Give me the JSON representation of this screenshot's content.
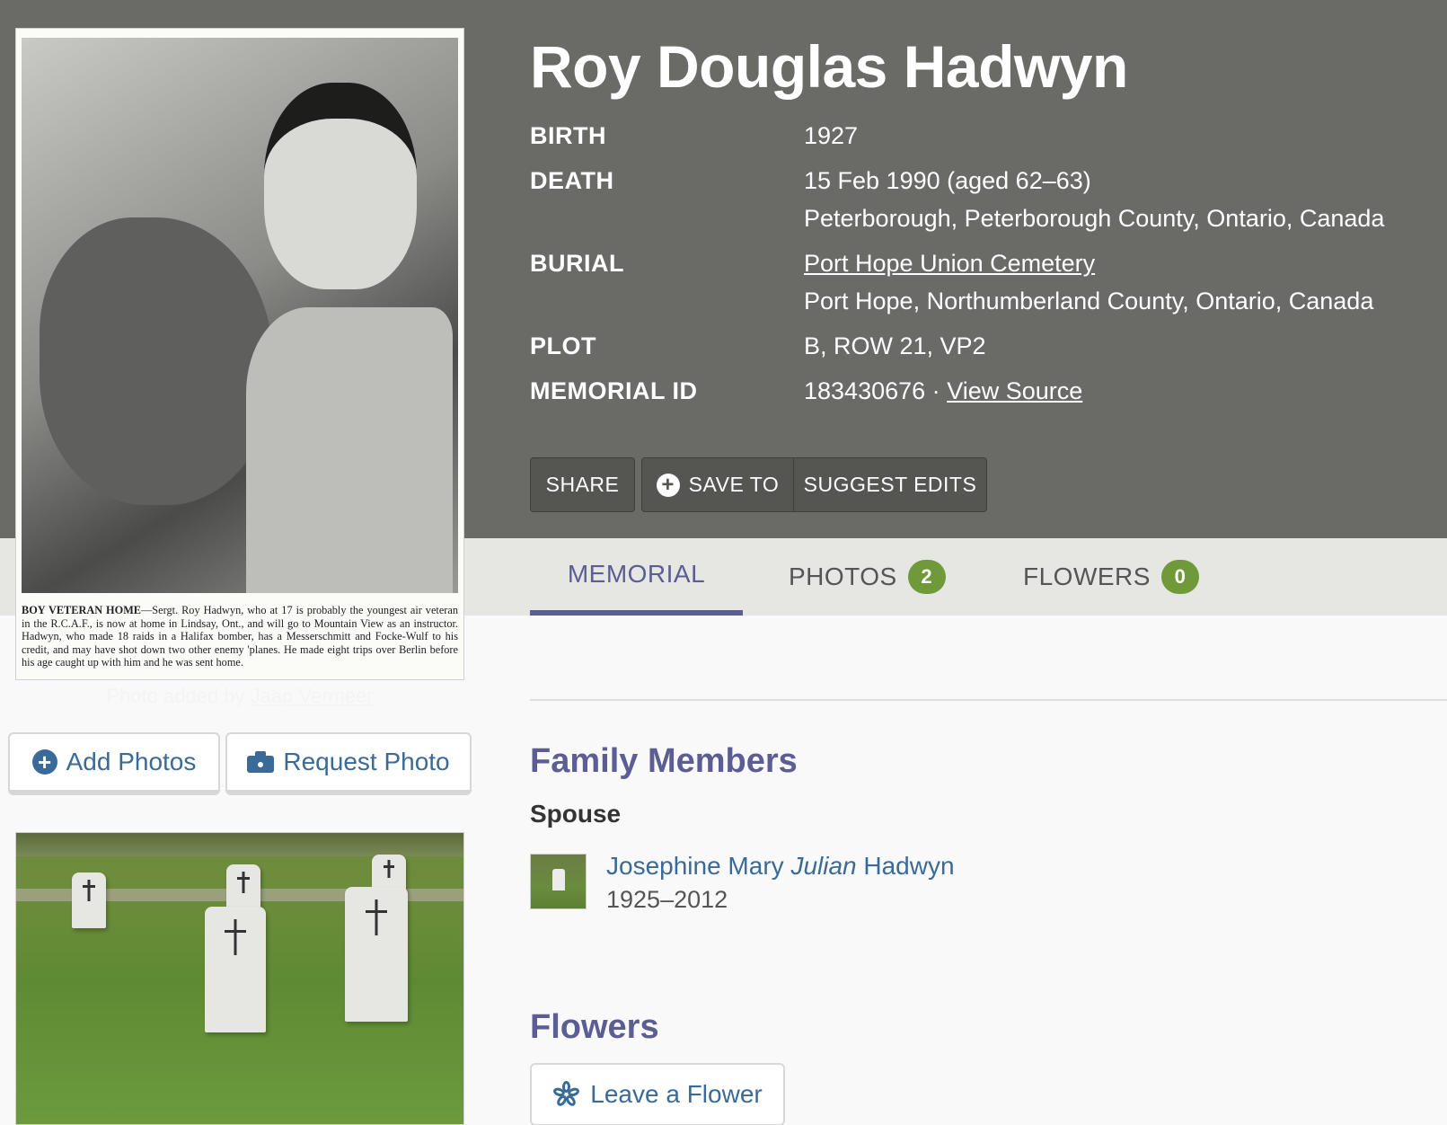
{
  "person": {
    "name": "Roy Douglas Hadwyn"
  },
  "facts": {
    "birth_label": "BIRTH",
    "birth_value": "1927",
    "death_label": "DEATH",
    "death_value": "15 Feb 1990 (aged 62–63)",
    "death_place": "Peterborough, Peterborough County, Ontario, Canada",
    "burial_label": "BURIAL",
    "burial_cemetery": "Port Hope Union Cemetery",
    "burial_place": "Port Hope, Northumberland County, Ontario, Canada",
    "plot_label": "PLOT",
    "plot_value": "B, ROW 21, VP2",
    "memorial_id_label": "MEMORIAL ID",
    "memorial_id_value": "183430676",
    "separator": "·",
    "view_source_label": "View Source"
  },
  "header_buttons": {
    "share": "SHARE",
    "save_to": "SAVE TO",
    "suggest_edits": "SUGGEST EDITS"
  },
  "tabs": {
    "memorial": "MEMORIAL",
    "photos": "PHOTOS",
    "photos_count": "2",
    "flowers": "FLOWERS",
    "flowers_count": "0"
  },
  "photo": {
    "caption_bold": "BOY VETERAN HOME",
    "caption_text": "—Sergt. Roy Hadwyn, who at 17 is probably the youngest air veteran in the R.C.A.F., is now at home in Lindsay, Ont., and will go to Mountain View as an instructor. Hadwyn, who made 18 raids in a Halifax bomber, has a Messerschmitt and Focke-Wulf to his credit, and may have shot down two other enemy 'planes. He made eight trips over Berlin before his age caught up with him and he was sent home.",
    "credit_prefix": "Photo added by",
    "credit_user": "Jaap Vermeer"
  },
  "photo_buttons": {
    "add_photos": "Add Photos",
    "request_photo": "Request Photo"
  },
  "family": {
    "title": "Family Members",
    "spouse_label": "Spouse",
    "spouse_first": "Josephine Mary",
    "spouse_maiden": "Julian",
    "spouse_last": "Hadwyn",
    "spouse_dates": "1925–2012"
  },
  "flowers": {
    "title": "Flowers",
    "leave_flower": "Leave a Flower"
  },
  "colors": {
    "header_bg": "#6a6a66",
    "accent_purple": "#5c5d93",
    "link_blue": "#3a6a97",
    "badge_green": "#6f9a3a"
  },
  "icons": {
    "add": "plus-circle-icon",
    "camera": "camera-icon",
    "save": "plus-circle-icon",
    "flower": "flower-icon"
  }
}
